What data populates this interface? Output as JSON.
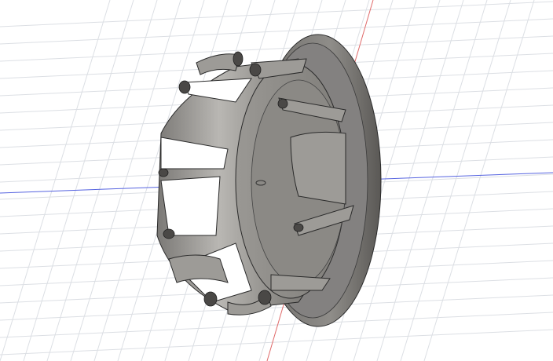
{
  "viewport": {
    "background": "#ffffff",
    "grid_color": "#d9dde2",
    "x_axis_color": "#e05050",
    "z_axis_color": "#4a5ae0"
  },
  "model": {
    "name_icon": "cap-plug-model",
    "body_color": "#8c8a86",
    "shade_color": "#5e5c59",
    "highlight_color": "#c9c7c3",
    "edge_color": "#2a2a2a"
  }
}
